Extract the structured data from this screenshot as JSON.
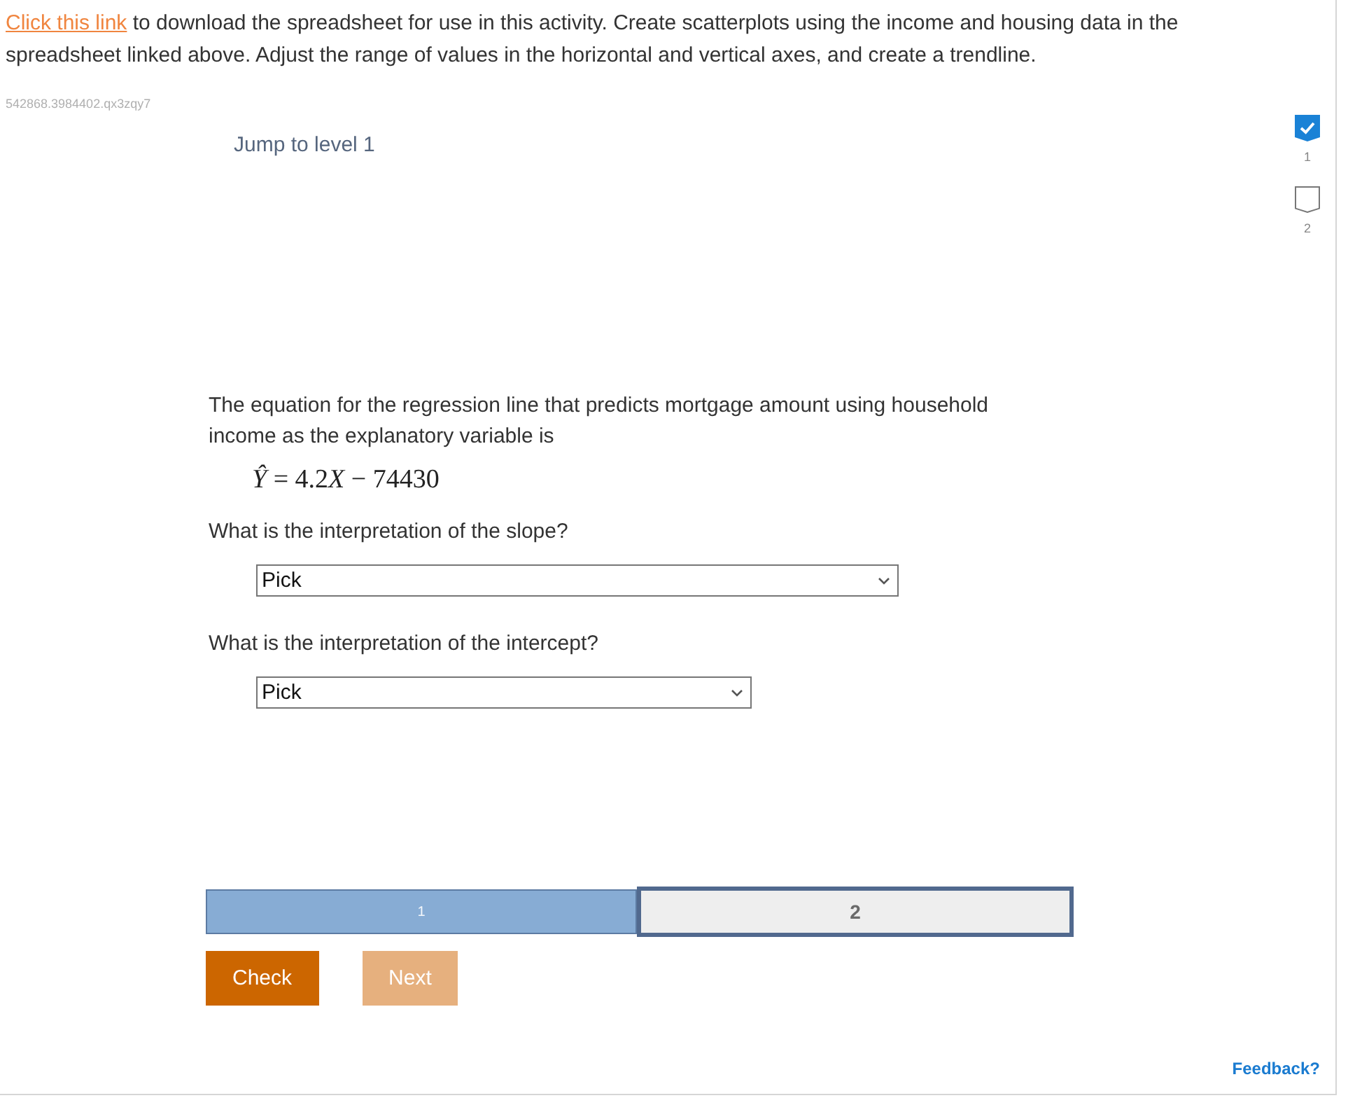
{
  "instructions": {
    "link": "Click this link",
    "text": " to download the spreadsheet for use in this activity. Create scatterplots using the income and housing data in the spreadsheet linked above. Adjust the range of values in the horizontal and vertical axes, and create a trendline."
  },
  "activity_id": "542868.3984402.qx3zqy7",
  "jump_link": "Jump to level 1",
  "level_markers": [
    {
      "label": "1",
      "completed": true
    },
    {
      "label": "2",
      "completed": false
    }
  ],
  "question": {
    "intro": "The equation for the regression line that predicts mortgage amount using household income as the explanatory variable is",
    "equation": [
      {
        "text": "Ŷ",
        "kind": "variable"
      },
      {
        "text": " = 4.2",
        "kind": "number"
      },
      {
        "text": "X",
        "kind": "variable"
      },
      {
        "text": " − 74430",
        "kind": "number"
      }
    ],
    "items": [
      {
        "prompt": "What is the interpretation of the slope?",
        "value": "Pick"
      },
      {
        "prompt": "What is the interpretation of the intercept?",
        "value": "Pick"
      }
    ]
  },
  "levels": [
    {
      "label": "1",
      "completed": true,
      "selected": false
    },
    {
      "label": "2",
      "completed": false,
      "selected": true
    }
  ],
  "buttons": [
    {
      "label": "Check",
      "disabled": false
    },
    {
      "label": "Next",
      "disabled": true
    }
  ],
  "feedback_link": "Feedback?"
}
